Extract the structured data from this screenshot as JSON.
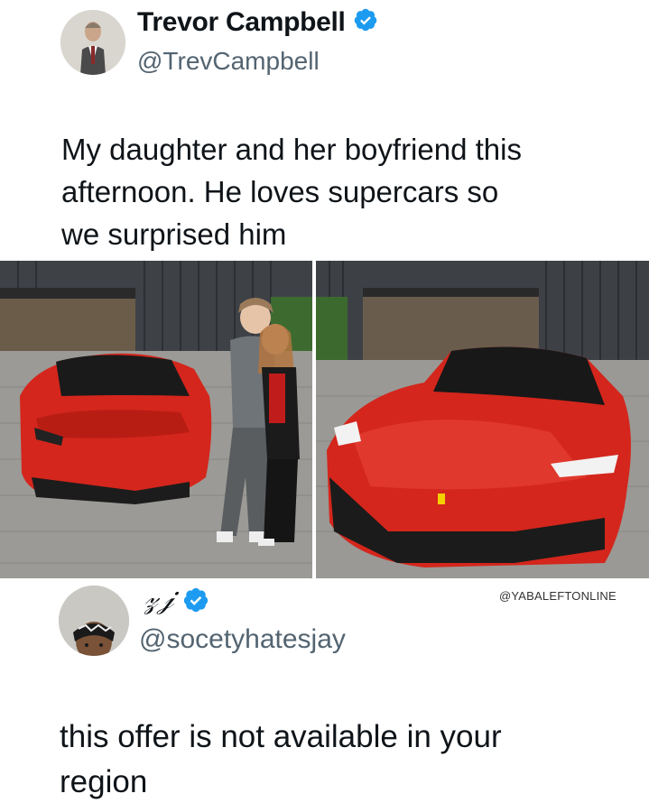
{
  "tweet1": {
    "display_name": "Trevor Campbell",
    "handle": "@TrevCampbell",
    "verified_icon": "verified-badge-icon",
    "text": "My daughter and her boyfriend this\nafternoon. He loves supercars so\nwe surprised him",
    "photos": [
      "couple-with-red-supercar-photo",
      "red-supercar-front-photo"
    ]
  },
  "tweet2": {
    "display_name": "𝓏𝒿",
    "handle": "@socetyhatesjay",
    "verified_icon": "verified-badge-icon",
    "text": "this offer is not available in your\nregion"
  },
  "watermark": "@YABALEFTONLINE",
  "colors": {
    "verified_blue": "#1d9bf0",
    "handle_gray": "#536471",
    "car_red": "#d4261c"
  }
}
